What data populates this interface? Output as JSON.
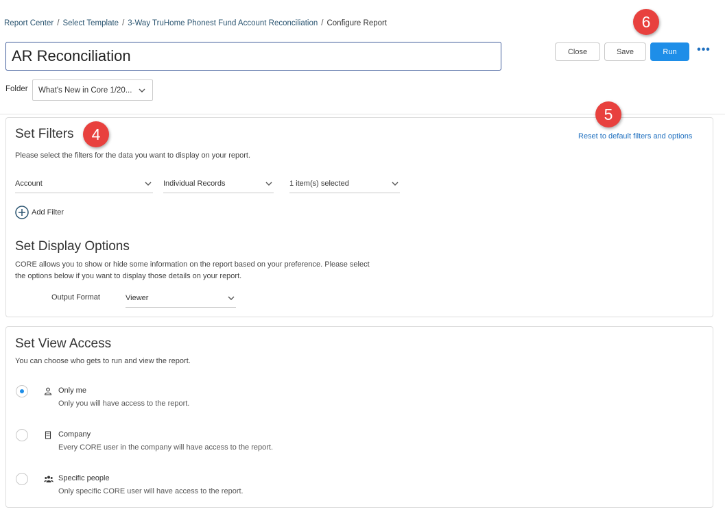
{
  "breadcrumb": {
    "items": [
      "Report Center",
      "Select Template",
      "3-Way TruHome Phonest Fund Account Reconciliation",
      "Configure Report"
    ],
    "separator": "/"
  },
  "report": {
    "title": "AR Reconciliation"
  },
  "folder": {
    "label": "Folder",
    "value": "What's New in Core 1/20..."
  },
  "toolbar": {
    "close_label": "Close",
    "save_label": "Save",
    "run_label": "Run",
    "more_label": "•••"
  },
  "annotations": {
    "step_4": "4",
    "step_5": "5",
    "step_6": "6"
  },
  "filters": {
    "heading": "Set Filters",
    "description": "Please select the filters for the data you want to display on your report.",
    "reset_label": "Reset to default filters and options",
    "selects": [
      {
        "value": "Account"
      },
      {
        "value": "Individual Records"
      },
      {
        "value": "1 item(s) selected"
      }
    ],
    "add_filter_label": "Add Filter"
  },
  "display_options": {
    "heading": "Set Display Options",
    "description_line1": "CORE allows you to show or hide some information on the report based on your preference. Please select",
    "description_line2": "the options below if you want to display those details on your report.",
    "output_format_label": "Output Format",
    "output_format_value": "Viewer"
  },
  "view_access": {
    "heading": "Set View Access",
    "description": "You can choose who gets to run and view the report.",
    "options": [
      {
        "label": "Only me",
        "description": "Only you will have access to the report.",
        "icon": "person-icon",
        "checked": true
      },
      {
        "label": "Company",
        "description": "Every CORE user in the company will have access to the report.",
        "icon": "building-icon",
        "checked": false
      },
      {
        "label": "Specific people",
        "description": "Only specific CORE user will have access to the report.",
        "icon": "group-icon",
        "checked": false
      }
    ]
  },
  "colors": {
    "primary": "#1e8ee8",
    "link": "#1e6fbf",
    "badge": "#e8413e",
    "title_border": "#3d5a99"
  }
}
